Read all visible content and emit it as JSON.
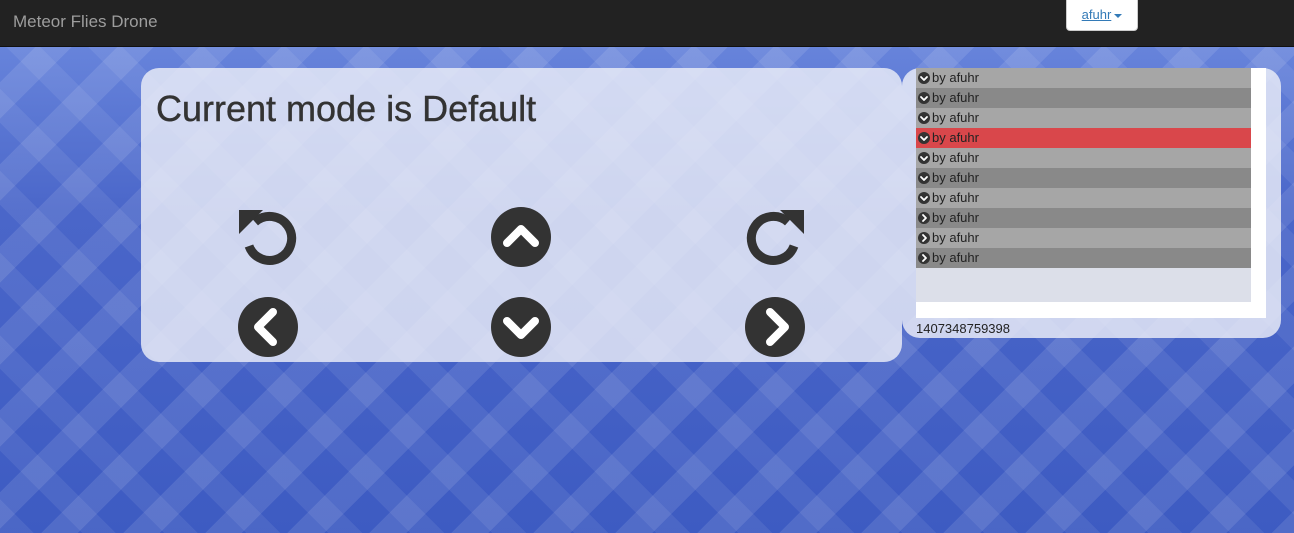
{
  "navbar": {
    "brand": "Meteor Flies Drone",
    "user": "afuhr"
  },
  "control": {
    "mode_title": "Current mode is Default",
    "buttons": [
      {
        "name": "rotate-left-button",
        "icon": "rotate-ccw-icon"
      },
      {
        "name": "forward-button",
        "icon": "chevron-up-circle-icon"
      },
      {
        "name": "rotate-right-button",
        "icon": "rotate-cw-icon"
      },
      {
        "name": "left-button",
        "icon": "chevron-left-circle-icon"
      },
      {
        "name": "backward-button",
        "icon": "chevron-down-circle-icon"
      },
      {
        "name": "right-button",
        "icon": "chevron-right-circle-icon"
      }
    ],
    "icon_color": "#333333"
  },
  "history": {
    "items": [
      {
        "label": "by afuhr",
        "icon": "chevron-down-circle-icon",
        "selected": false
      },
      {
        "label": "by afuhr",
        "icon": "chevron-down-circle-icon",
        "selected": false
      },
      {
        "label": "by afuhr",
        "icon": "chevron-down-circle-icon",
        "selected": false
      },
      {
        "label": "by afuhr",
        "icon": "chevron-down-circle-icon",
        "selected": true
      },
      {
        "label": "by afuhr",
        "icon": "chevron-down-circle-icon",
        "selected": false
      },
      {
        "label": "by afuhr",
        "icon": "chevron-down-circle-icon",
        "selected": false
      },
      {
        "label": "by afuhr",
        "icon": "chevron-down-circle-icon",
        "selected": false
      },
      {
        "label": "by afuhr",
        "icon": "chevron-right-circle-icon",
        "selected": false
      },
      {
        "label": "by afuhr",
        "icon": "chevron-right-circle-icon",
        "selected": false
      },
      {
        "label": "by afuhr",
        "icon": "chevron-right-circle-icon",
        "selected": false
      }
    ],
    "timestamp": "1407348759398",
    "selected_color": "#d9474b"
  }
}
